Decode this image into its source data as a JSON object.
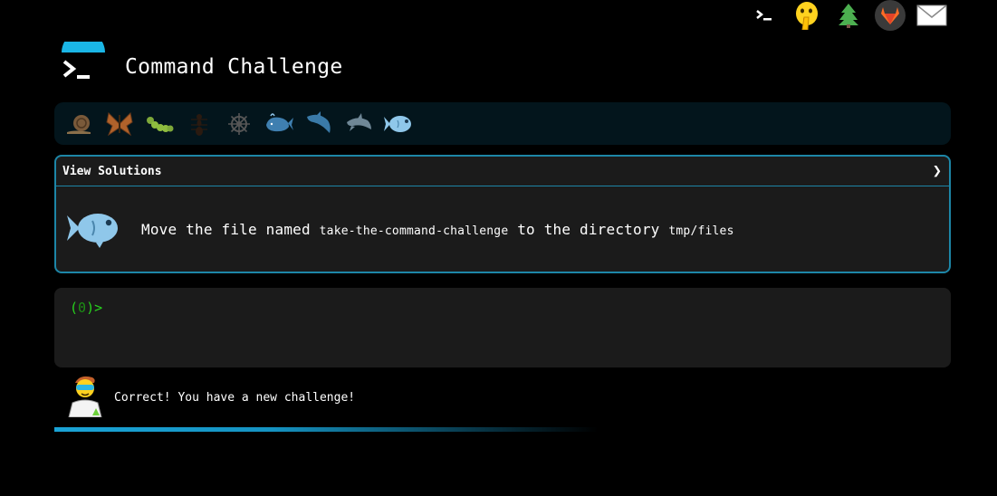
{
  "top_icons": [
    "terminal-icon",
    "shushing-face-icon",
    "evergreen-tree-icon",
    "gitlab-icon",
    "envelope-icon"
  ],
  "header": {
    "title": "Command Challenge",
    "logo": "terminal-logo-icon"
  },
  "levels": [
    "snail-icon",
    "butterfly-icon",
    "caterpillar-icon",
    "ant-icon",
    "ships-wheel-icon",
    "whale-icon",
    "dolphin-icon",
    "dolphin-icon",
    "fish-icon"
  ],
  "panel": {
    "toggle_label": "View Solutions",
    "challenge": {
      "part1": "Move the file named ",
      "file": "take-the-command-challenge",
      "part2": " to the directory ",
      "dir": "tmp/files"
    }
  },
  "terminal": {
    "prompt_open": "(",
    "prompt_count": "0",
    "prompt_close": ")>"
  },
  "status": {
    "message": "Correct! You have a new challenge!"
  },
  "colors": {
    "accent": "#1d86a7",
    "prompt": "#27d21d",
    "progress": "#1aa3d6"
  }
}
